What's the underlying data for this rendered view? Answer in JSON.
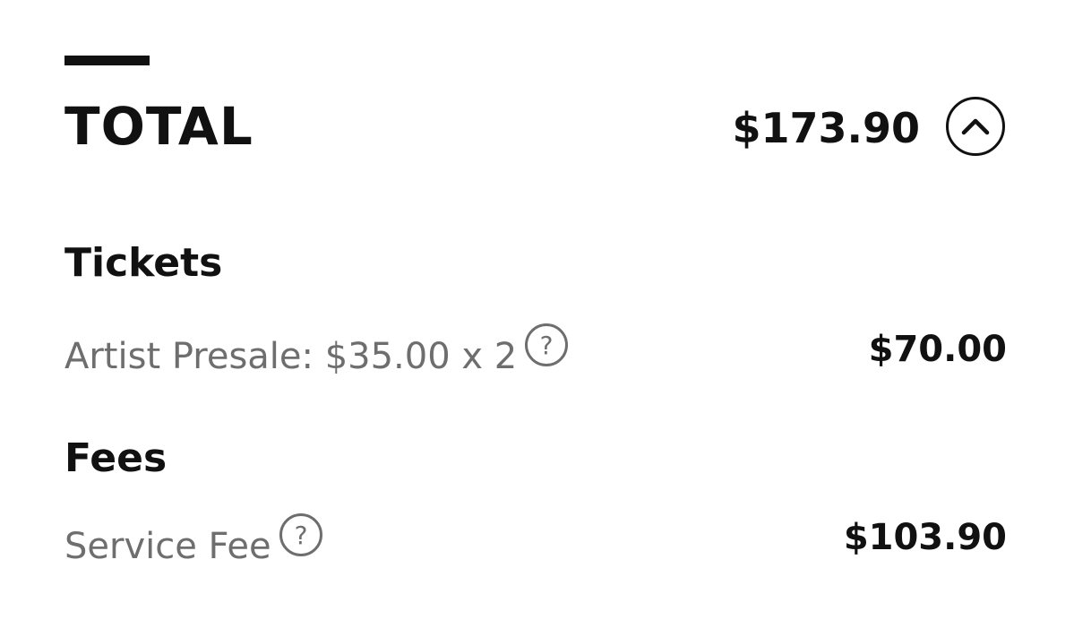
{
  "summary": {
    "total_label": "TOTAL",
    "total_value": "$173.90",
    "toggle_icon": "chevron-up-icon"
  },
  "tickets": {
    "heading": "Tickets",
    "items": [
      {
        "label": "Artist Presale: $35.00 x 2",
        "amount": "$70.00",
        "help_icon": "question-circle-icon"
      }
    ]
  },
  "fees": {
    "heading": "Fees",
    "items": [
      {
        "label": "Service Fee",
        "amount": "$103.90",
        "help_icon": "question-circle-icon"
      }
    ]
  },
  "colors": {
    "text_primary": "#111111",
    "text_secondary": "#6e6e6e",
    "background": "#ffffff"
  }
}
